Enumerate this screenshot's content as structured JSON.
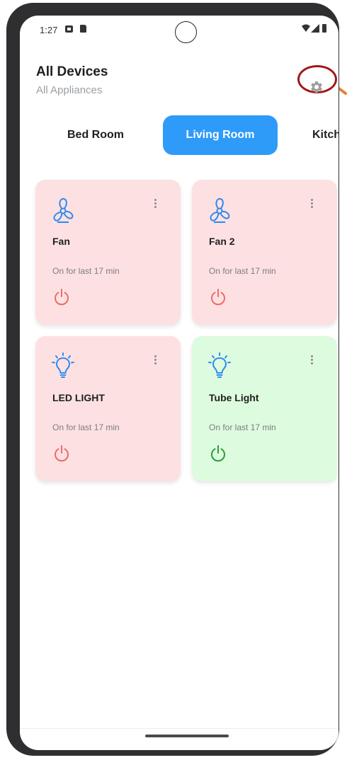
{
  "status_bar": {
    "time": "1:27"
  },
  "header": {
    "title": "All Devices",
    "subtitle": "All Appliances",
    "settings_icon": "gear-icon"
  },
  "tabs": [
    {
      "label": "Bed Room",
      "selected": false
    },
    {
      "label": "Living Room",
      "selected": true
    },
    {
      "label": "Kitchen",
      "selected": false
    }
  ],
  "devices": [
    {
      "name": "Fan",
      "status": "On for last 17 min",
      "icon": "fan-icon",
      "state": "off"
    },
    {
      "name": "Fan 2",
      "status": "On for last 17 min",
      "icon": "fan-icon",
      "state": "off"
    },
    {
      "name": "LED LIGHT",
      "status": "On for last 17 min",
      "icon": "bulb-icon",
      "state": "off"
    },
    {
      "name": "Tube Light",
      "status": "On for last 17 min",
      "icon": "bulb-icon",
      "state": "on"
    }
  ],
  "colors": {
    "accent": "#2e9bf9",
    "card_off_bg": "#fde1e2",
    "card_on_bg": "#ddfbde",
    "power_off": "#ee6b6b",
    "power_on": "#2e9e3e",
    "icon_blue": "#2e8af0",
    "highlight_ring": "#a11818",
    "arrow": "#e8813c"
  }
}
